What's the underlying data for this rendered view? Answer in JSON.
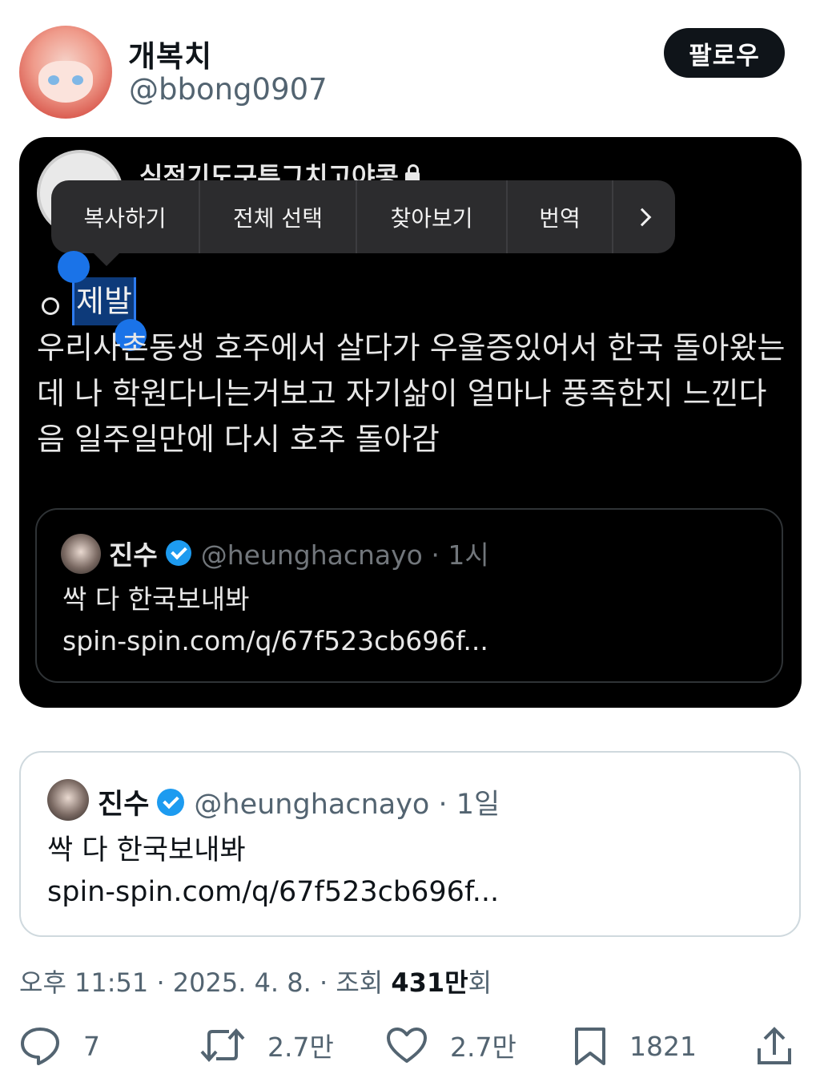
{
  "author": {
    "display_name": "개복치",
    "handle": "@bbong0907"
  },
  "follow_label": "팔로우",
  "screenshot": {
    "account_name": "심적기도구투그치고야콩",
    "context_menu": [
      "복사하기",
      "전체 선택",
      "찾아보기",
      "번역"
    ],
    "selected_word": "제발",
    "body": "우리사촌동생 호주에서 살다가 우울증있어서 한국 돌아왔는데 나 학원다니는거보고 자기삶이 얼마나 풍족한지 느낀다음 일주일만에 다시 호주 돌아감",
    "quote": {
      "name": "진수",
      "meta": "@heunghacnayo · 1시",
      "text": "싹 다 한국보내봐",
      "link": "spin-spin.com/q/67f523cb696f..."
    }
  },
  "quote": {
    "name": "진수",
    "meta": "@heunghacnayo · 1일",
    "text": "싹 다 한국보내봐",
    "link": "spin-spin.com/q/67f523cb696f..."
  },
  "timestamp": {
    "prefix": "오후 11:51 · 2025. 4. 8. · 조회 ",
    "views": "431만",
    "suffix": "회"
  },
  "actions": {
    "replies": "7",
    "reposts": "2.7만",
    "likes": "2.7만",
    "bookmarks": "1821"
  },
  "colors": {
    "verified": "#1d9bf0",
    "selection": "#0d3a7a",
    "handle_blue": "#1a73e8"
  }
}
